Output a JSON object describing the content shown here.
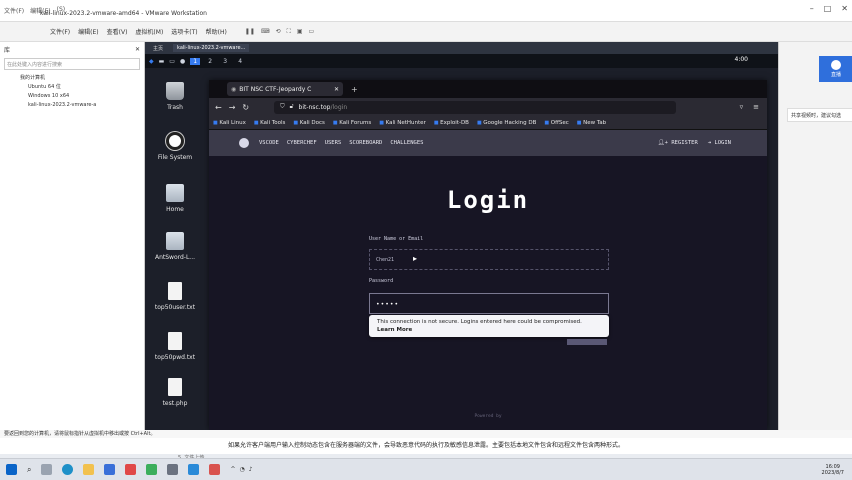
{
  "vmware": {
    "titlebar_left": [
      "文件(F)",
      "编辑(E)",
      "(S)"
    ],
    "window_title": "kali-linux-2023.2-vmware-amd64 - VMware Workstation",
    "menus": [
      "文件(F)",
      "编辑(E)",
      "查看(V)",
      "虚拟机(M)",
      "选项卡(T)",
      "帮助(H)"
    ],
    "library_title": "库",
    "library_search": "在此处键入内容进行搜索",
    "library_tree": [
      "我的计算机",
      "Ubuntu 64 位",
      "Windows 10 x64",
      "kali-linux-2023.2-vmware-a"
    ],
    "vm_tabs": [
      "主页",
      "kali-linux-2023.2-vmware..."
    ],
    "status_bar": "要返回到您的计算机，请将鼠标指针从虚拟机中移出或按 Ctrl+Alt。"
  },
  "kali": {
    "workspaces": [
      "1",
      "2",
      "3",
      "4"
    ],
    "active_workspace": "1",
    "clock": "4:00",
    "desktop_icons": [
      {
        "label": "Trash",
        "icon": "trash-icon"
      },
      {
        "label": "File System",
        "icon": "filesystem-icon"
      },
      {
        "label": "Home",
        "icon": "home-folder-icon"
      },
      {
        "label": "AntSword-L...",
        "icon": "folder-icon"
      },
      {
        "label": "top50user.txt",
        "icon": "text-file-icon"
      },
      {
        "label": "top50pwd.txt",
        "icon": "text-file-icon"
      },
      {
        "label": "test.php",
        "icon": "php-file-icon"
      }
    ]
  },
  "firefox": {
    "tab_title": "BIT NSC CTF-Jeopardy C",
    "url_host": "bit-nsc.top",
    "url_path": "/login",
    "bookmarks": [
      "Kali Linux",
      "Kali Tools",
      "Kali Docs",
      "Kali Forums",
      "Kali NetHunter",
      "Exploit-DB",
      "Google Hacking DB",
      "OffSec",
      "New Tab"
    ]
  },
  "ctf": {
    "nav_left": [
      "VSCODE",
      "CYBERCHEF",
      "USERS",
      "SCOREBOARD",
      "CHALLENGES"
    ],
    "register": "REGISTER",
    "login": "LOGIN",
    "title": "Login",
    "username_label": "User Name or Email",
    "username_value": "Chen21",
    "password_label": "Password",
    "password_value": "•••••",
    "warning_text": "This connection is not secure. Logins entered here could be compromised.",
    "warning_link": "Learn More",
    "powered_by": "Powered by"
  },
  "side": {
    "live_label": "直播",
    "note": "共享视频时，建议勾选"
  },
  "subtitle": "如果允许客户端用户输入控制动态包含在服务器端的文件，会导致恶意代码的执行及敏感信息泄露。主要包括本地文件包含和远程文件包含两种形式。",
  "subtitle_small": "5. 文件上传",
  "taskbar": {
    "time": "16:09",
    "date": "2023/8/7"
  }
}
